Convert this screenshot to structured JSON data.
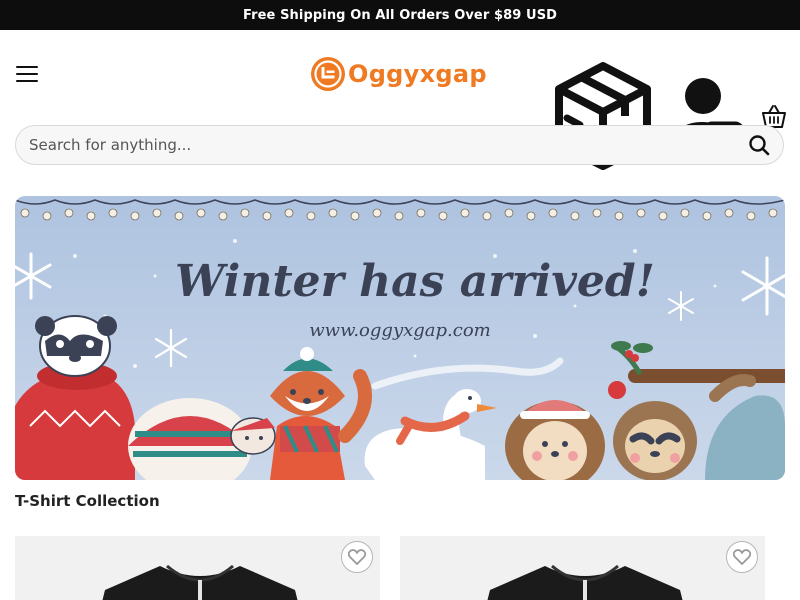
{
  "announcement": "Free Shipping On All Orders Over $89 USD",
  "header": {
    "menu_icon": "hamburger-menu-icon",
    "logo_text": "Oggyxgap",
    "icons": [
      "package-box-icon",
      "user-login-icon",
      "shopping-basket-icon"
    ]
  },
  "search": {
    "placeholder": "Search for anything...",
    "value": "",
    "icon": "search-icon"
  },
  "banner": {
    "headline": "Winter has arrived!",
    "url_text": "www.oggyxgap.com"
  },
  "collection": {
    "title": "T-Shirt Collection",
    "wishlist_icon": "heart-icon"
  },
  "colors": {
    "brand_orange": "#f07a22",
    "topbar_bg": "#0d0d0d",
    "banner_bg": "#b9cbe4",
    "banner_text": "#3b4256"
  }
}
